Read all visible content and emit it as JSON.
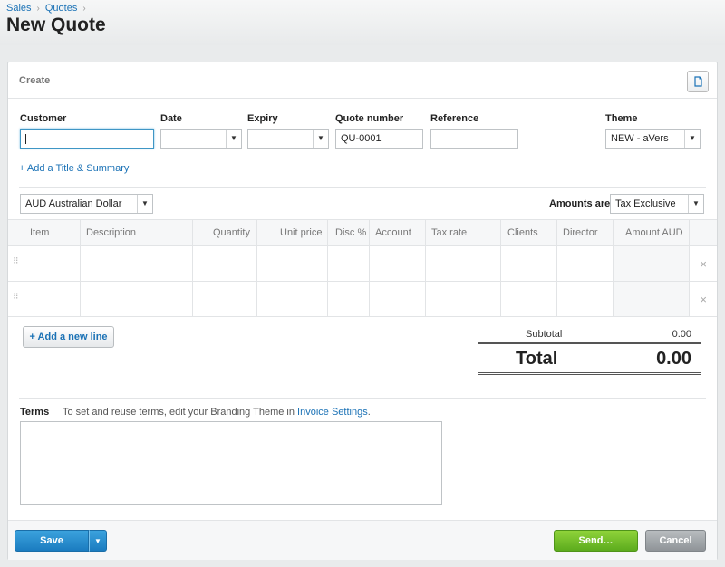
{
  "breadcrumb": {
    "items": [
      "Sales",
      "Quotes"
    ],
    "separator": "›"
  },
  "page": {
    "title": "New Quote"
  },
  "card": {
    "create_label": "Create",
    "copy_icon": "copy-icon"
  },
  "form": {
    "customer": {
      "label": "Customer",
      "value": ""
    },
    "date": {
      "label": "Date",
      "value": ""
    },
    "expiry": {
      "label": "Expiry",
      "value": ""
    },
    "quote_number": {
      "label": "Quote number",
      "value": "QU-0001"
    },
    "reference": {
      "label": "Reference",
      "value": ""
    },
    "theme": {
      "label": "Theme",
      "value": "NEW - aVers"
    },
    "add_title_link": "+ Add a Title & Summary",
    "currency": {
      "value": "AUD Australian Dollar"
    },
    "amounts_are": {
      "label": "Amounts are",
      "value": "Tax Exclusive"
    }
  },
  "table": {
    "columns": [
      "Item",
      "Description",
      "Quantity",
      "Unit price",
      "Disc %",
      "Account",
      "Tax rate",
      "Clients",
      "Director",
      "Amount AUD"
    ],
    "row_count": 2,
    "delete_icon": "×",
    "drag_icon": "⠿"
  },
  "actions": {
    "add_line": "+ Add a new line"
  },
  "totals": {
    "subtotal_label": "Subtotal",
    "subtotal_value": "0.00",
    "total_label": "Total",
    "total_value": "0.00"
  },
  "terms": {
    "label": "Terms",
    "hint_prefix": "To set and reuse terms, edit your Branding Theme in ",
    "hint_link": "Invoice Settings",
    "hint_suffix": ".",
    "value": ""
  },
  "footer": {
    "save": "Save",
    "send": "Send…",
    "cancel": "Cancel"
  },
  "colors": {
    "link": "#1b72b6",
    "save": "#2a8ed0",
    "send": "#76c02c",
    "cancel": "#a3a7aa"
  }
}
